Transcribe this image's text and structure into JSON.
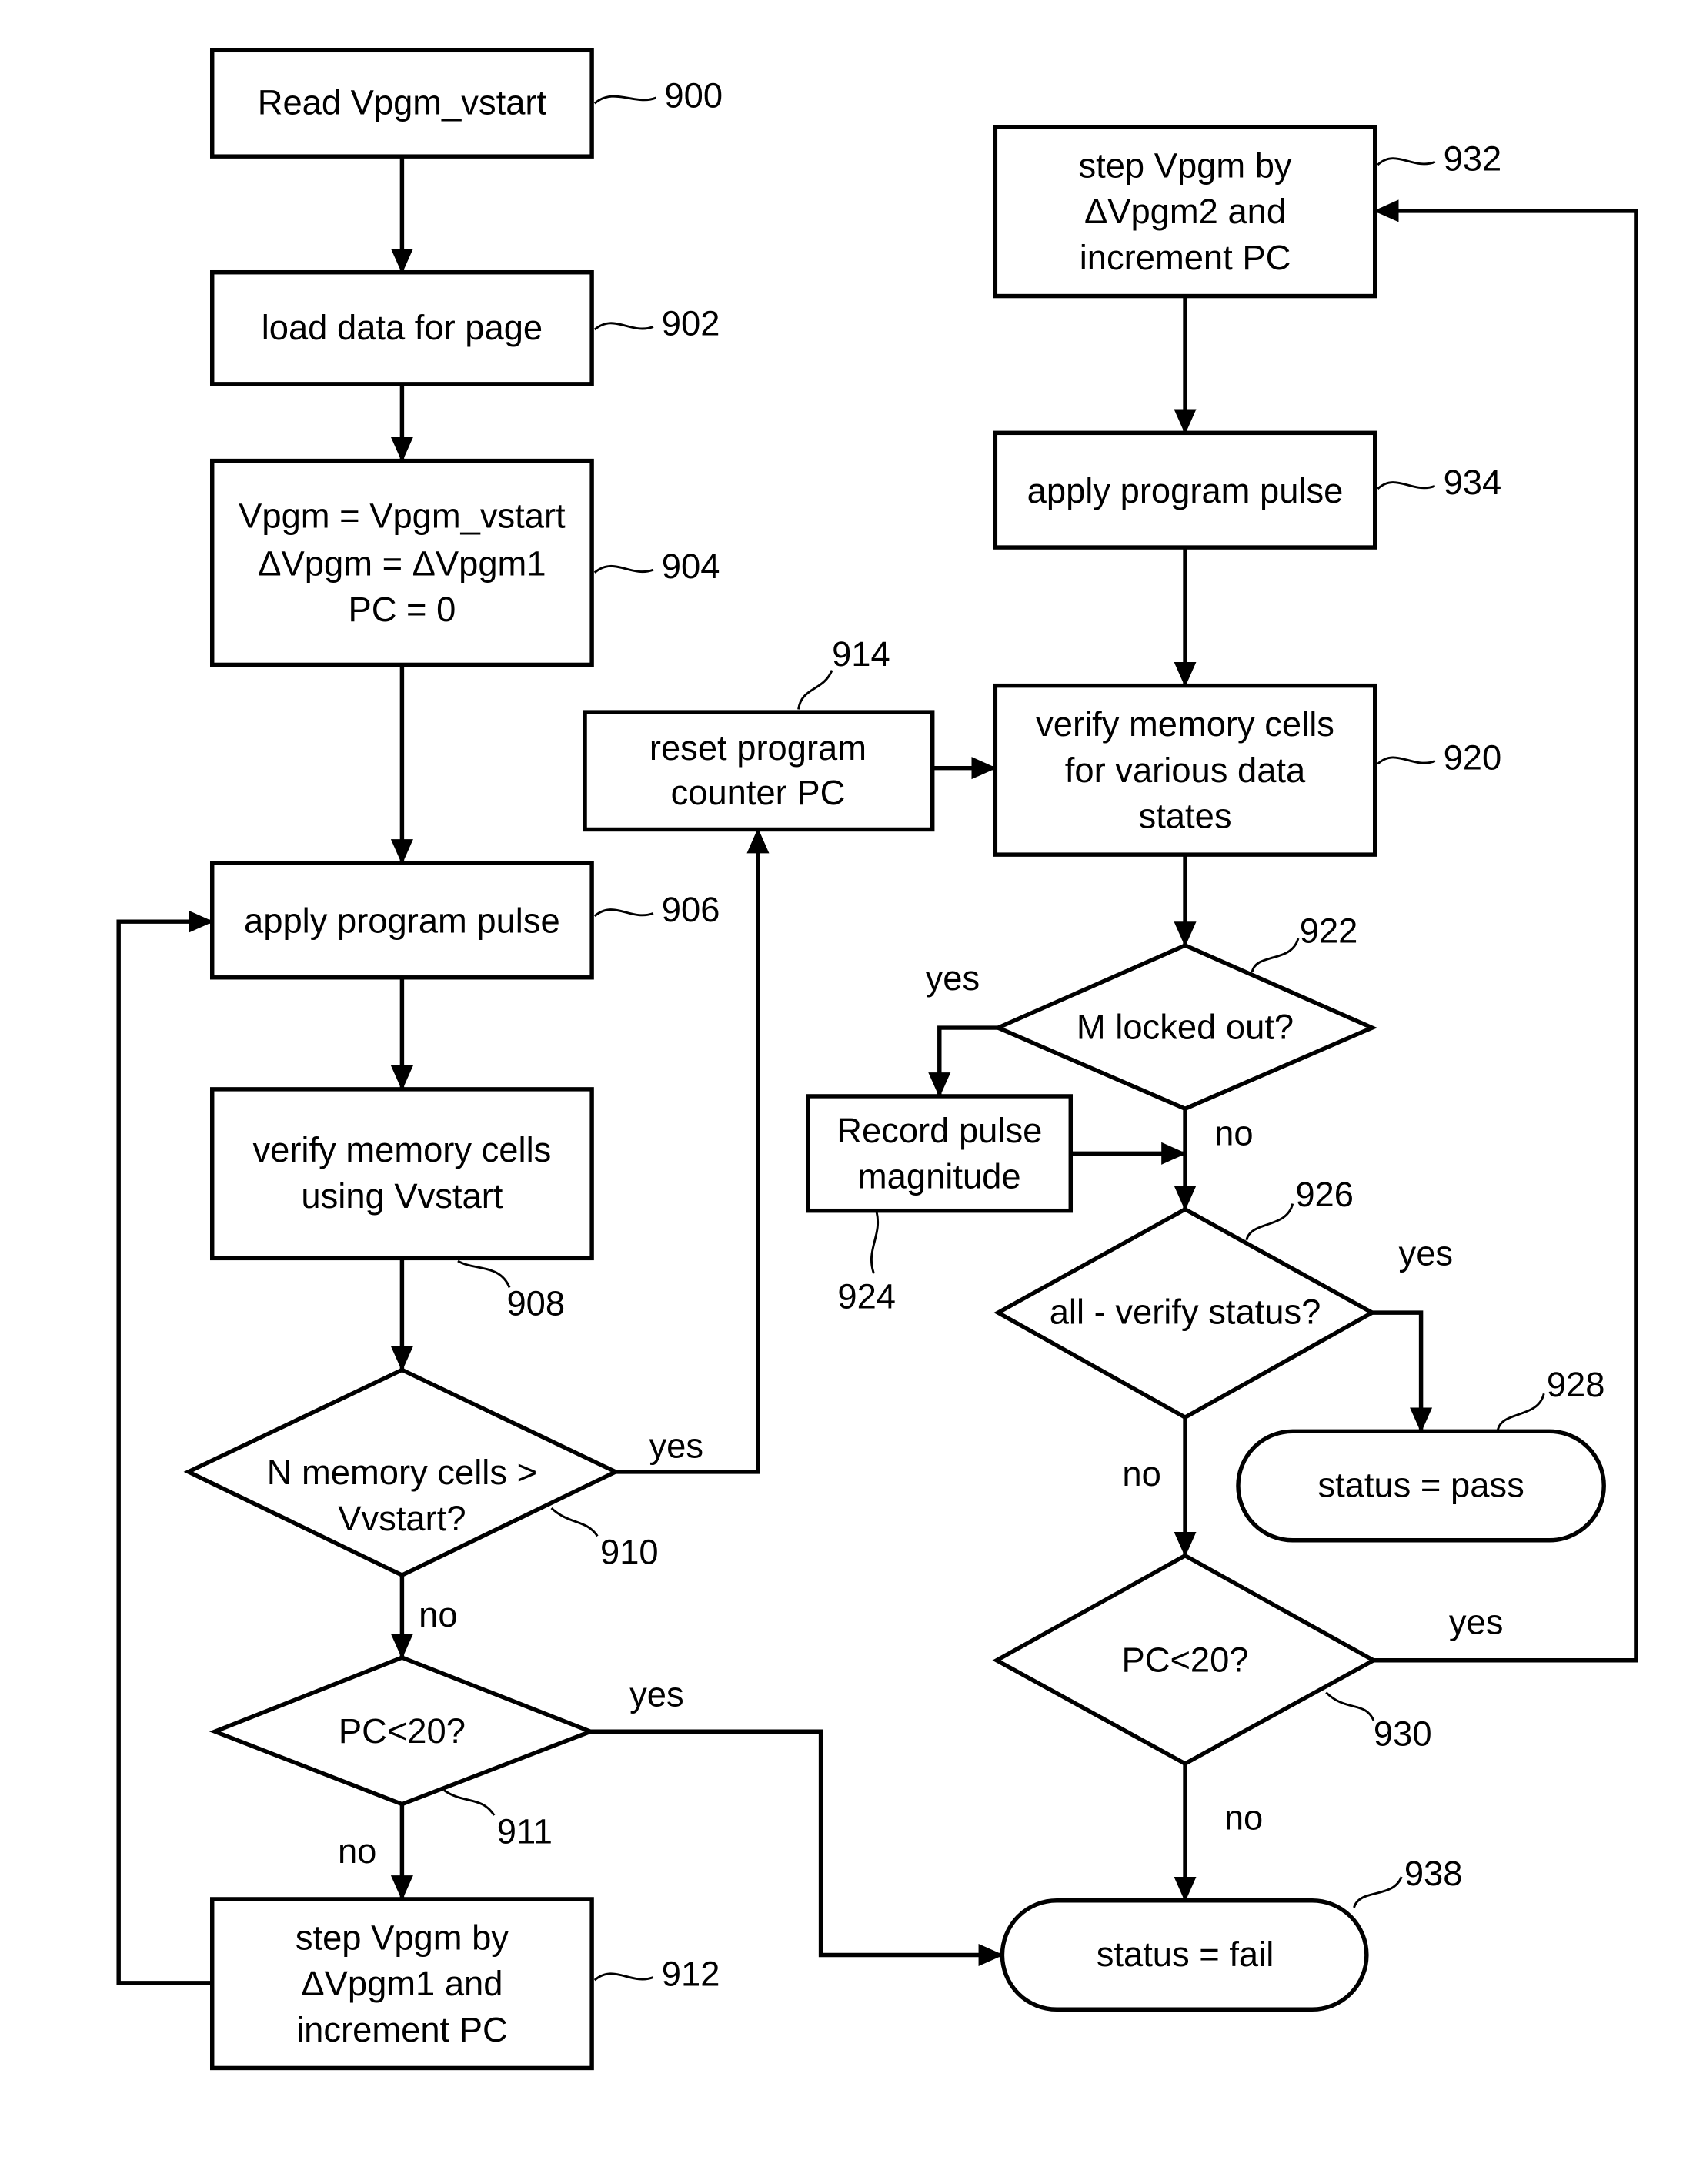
{
  "diagram": {
    "nodes": {
      "n900": {
        "ref": "900",
        "lines": [
          "Read Vpgm_vstart"
        ]
      },
      "n902": {
        "ref": "902",
        "lines": [
          "load data for page"
        ]
      },
      "n904": {
        "ref": "904",
        "lines": [
          "Vpgm = Vpgm_vstart",
          "ΔVpgm = ΔVpgm1",
          "PC = 0"
        ]
      },
      "n906": {
        "ref": "906",
        "lines": [
          "apply program pulse"
        ]
      },
      "n908": {
        "ref": "908",
        "lines": [
          "verify memory cells",
          "using Vvstart"
        ]
      },
      "n910": {
        "ref": "910",
        "lines": [
          "N memory cells >",
          "Vvstart?"
        ]
      },
      "n911": {
        "ref": "911",
        "lines": [
          "PC<20?"
        ]
      },
      "n912": {
        "ref": "912",
        "lines": [
          "step Vpgm by",
          "ΔVpgm1 and",
          "increment PC"
        ]
      },
      "n914": {
        "ref": "914",
        "lines": [
          "reset program",
          "counter PC"
        ]
      },
      "n920": {
        "ref": "920",
        "lines": [
          "verify memory cells",
          "for various data",
          "states"
        ]
      },
      "n922": {
        "ref": "922",
        "lines": [
          "M locked out?"
        ]
      },
      "n924": {
        "ref": "924",
        "lines": [
          "Record pulse",
          "magnitude"
        ]
      },
      "n926": {
        "ref": "926",
        "lines": [
          "all - verify status?"
        ]
      },
      "n928": {
        "ref": "928",
        "lines": [
          "status = pass"
        ]
      },
      "n930": {
        "ref": "930",
        "lines": [
          "PC<20?"
        ]
      },
      "n932": {
        "ref": "932",
        "lines": [
          "step Vpgm by",
          "ΔVpgm2 and",
          "increment PC"
        ]
      },
      "n934": {
        "ref": "934",
        "lines": [
          "apply program pulse"
        ]
      },
      "n938": {
        "ref": "938",
        "lines": [
          "status = fail"
        ]
      }
    },
    "edge_labels": {
      "e910_yes": "yes",
      "e910_no": "no",
      "e911_yes": "yes",
      "e911_no": "no",
      "e922_yes": "yes",
      "e922_no": "no",
      "e926_yes": "yes",
      "e926_no": "no",
      "e930_yes": "yes",
      "e930_no": "no"
    }
  }
}
